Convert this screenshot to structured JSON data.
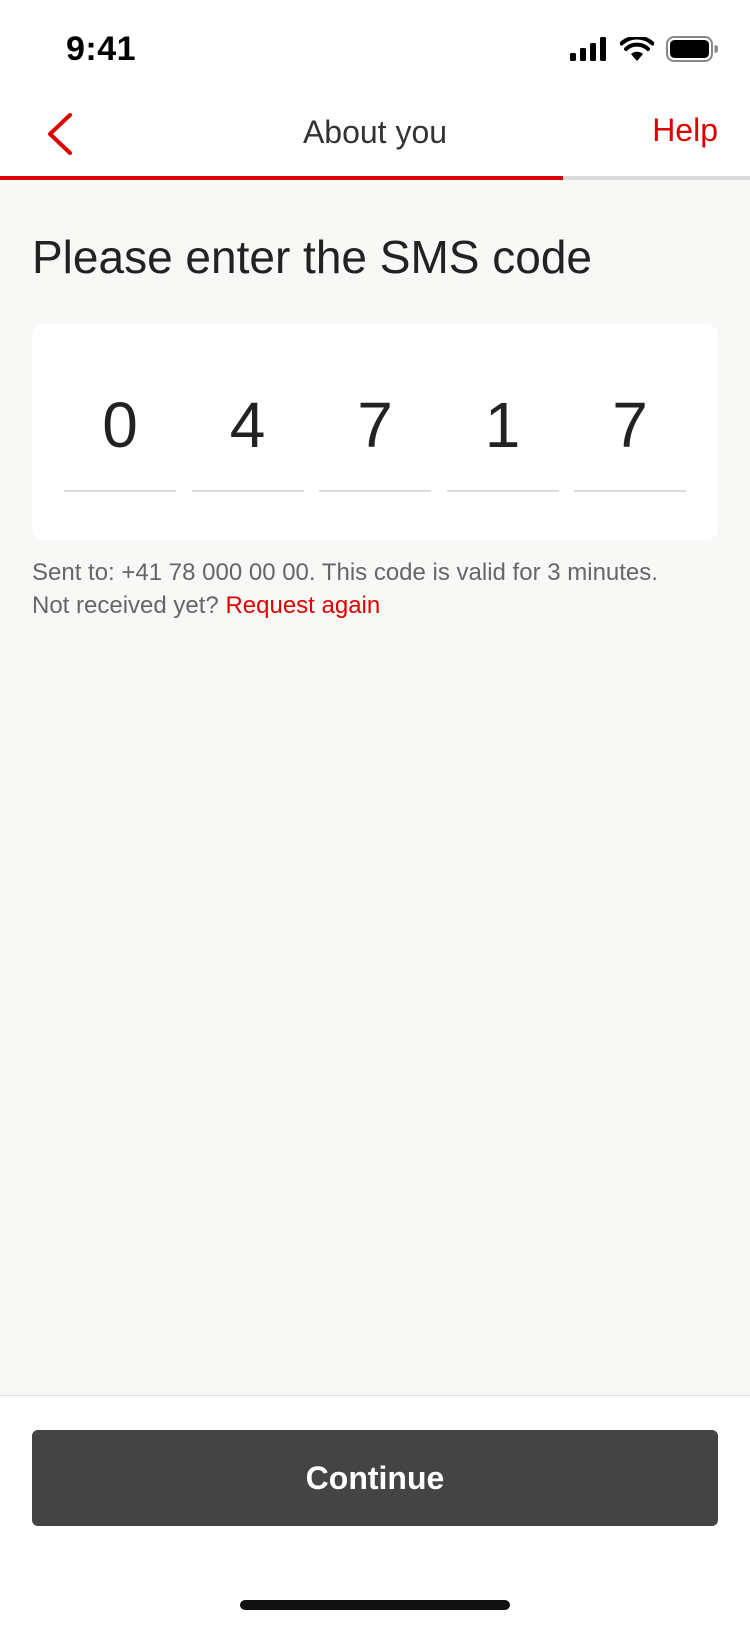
{
  "status_bar": {
    "time": "9:41"
  },
  "nav": {
    "title": "About you",
    "help_label": "Help",
    "progress": 0.75
  },
  "main": {
    "title": "Please enter the SMS code",
    "code_digits": [
      "0",
      "4",
      "7",
      "1",
      "7"
    ],
    "info_line": "Sent to: +41 78 000 00 00. This code is valid for 3 minutes.",
    "not_received": "Not received yet?",
    "request_again": "Request again"
  },
  "footer": {
    "continue_label": "Continue"
  },
  "colors": {
    "accent": "#e00000",
    "button": "#444444",
    "background": "#f8f8f7"
  },
  "icons": {
    "back": "chevron-left-icon",
    "signal": "cellular-signal-icon",
    "wifi": "wifi-icon",
    "battery": "battery-icon"
  }
}
